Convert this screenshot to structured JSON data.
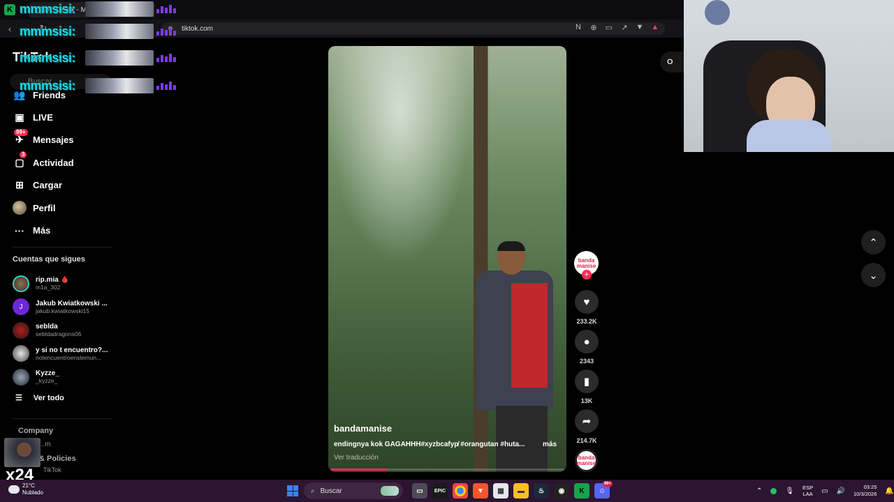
{
  "browser": {
    "tab_title": "(99+) TikTok - Ma",
    "url": "tiktok.com"
  },
  "overlay": {
    "chat_name": "mmmsisi:",
    "rows": 4
  },
  "sidebar": {
    "logo": "TikTok",
    "search_placeholder": "Buscar",
    "menu": [
      {
        "label": "Friends",
        "icon": "friends-icon"
      },
      {
        "label": "LIVE",
        "icon": "live-icon"
      },
      {
        "label": "Mensajes",
        "icon": "messages-icon",
        "badge": "99+"
      },
      {
        "label": "Actividad",
        "icon": "activity-icon",
        "badge": "3"
      },
      {
        "label": "Cargar",
        "icon": "upload-icon"
      },
      {
        "label": "Perfil",
        "icon": "profile-avatar"
      },
      {
        "label": "Más",
        "icon": "more-icon"
      }
    ],
    "following_title": "Cuentas que sigues",
    "following": [
      {
        "name": "rip.mia 🩸",
        "handle": "m1a_302",
        "initial": ""
      },
      {
        "name": "Jakub Kwiatkowski ...",
        "handle": "jakub.kwiatkowski15",
        "initial": "J"
      },
      {
        "name": "seblda",
        "handle": "sebldadragons06",
        "initial": ""
      },
      {
        "name": "y si no t encuentro?...",
        "handle": "notencuentroenstemun...",
        "initial": ""
      },
      {
        "name": "Kyzze_",
        "handle": "_kyzze_",
        "initial": ""
      }
    ],
    "see_all": "Ver todo",
    "company": "Company",
    "footer_program": "...m",
    "footer_policies": "& Policies",
    "footer_copyright": "TikTok",
    "x24": "x24"
  },
  "video": {
    "username": "bandamanise",
    "caption": "endingnya kok GAGAHHH#xyzbcafyp̸ #orangutan #huta...",
    "more": "más",
    "translate": "Ver traducción",
    "progress": 0.24
  },
  "actions": {
    "creator_badge": "banda manise",
    "likes": "233.2K",
    "comments": "2343",
    "saves": "13K",
    "shares": "214.7K"
  },
  "side_pill": "O",
  "taskbar": {
    "temperature": "21°C",
    "condition": "Nublado",
    "search": "Buscar",
    "lang_top": "ESP",
    "lang_bottom": "LAA",
    "time": "03:25",
    "date": "10/3/2026",
    "discord_badge": "99+"
  },
  "colors": {
    "accent": "#fe2c55",
    "taskbar": "#2b1530"
  }
}
